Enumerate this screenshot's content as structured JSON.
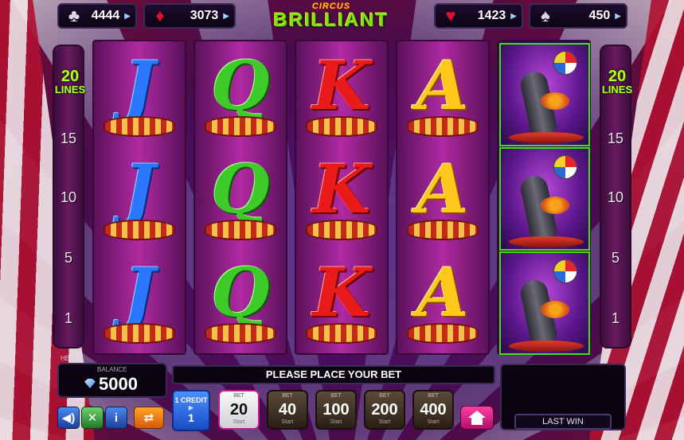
{
  "jackpots": [
    {
      "suit": "clubs",
      "glyph": "♣",
      "value": "4444",
      "color": "black"
    },
    {
      "suit": "diamonds",
      "glyph": "♦",
      "value": "3073",
      "color": "red"
    },
    {
      "suit": "hearts",
      "glyph": "♥",
      "value": "1423",
      "color": "red"
    },
    {
      "suit": "spades",
      "glyph": "♠",
      "value": "450",
      "color": "black"
    }
  ],
  "logo": {
    "small": "CIRCUS",
    "big": "BRILLIANT"
  },
  "lines": {
    "count": "20",
    "word": "LINES",
    "markers": [
      "15",
      "10",
      "5",
      "1"
    ]
  },
  "reels": [
    {
      "symbol": "J",
      "cells": [
        "J",
        "J",
        "J"
      ]
    },
    {
      "symbol": "Q",
      "cells": [
        "Q",
        "Q",
        "Q"
      ]
    },
    {
      "symbol": "K",
      "cells": [
        "K",
        "K",
        "K"
      ]
    },
    {
      "symbol": "A",
      "cells": [
        "A",
        "A",
        "A"
      ]
    },
    {
      "symbol": "seal",
      "cells": [
        "seal",
        "seal",
        "seal"
      ]
    }
  ],
  "panel": {
    "help": "HELP",
    "balance_label": "BALANCE",
    "balance_value": "5000",
    "message": "PLEASE PLACE YOUR BET",
    "last_win_label": "LAST WIN",
    "credit_label": "1 CREDIT",
    "credit_value": "1",
    "bet_label": "BET",
    "start_label": "Start",
    "bets": [
      "20",
      "40",
      "100",
      "200",
      "400"
    ],
    "active_bet": "20"
  },
  "controls": [
    "sound-icon",
    "fullscreen-icon",
    "info-icon",
    "gamble-icon",
    "home-icon"
  ]
}
